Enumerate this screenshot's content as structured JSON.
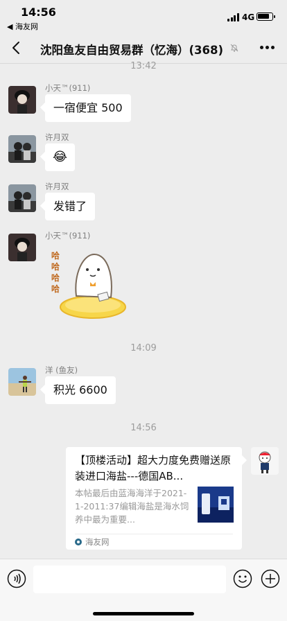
{
  "status_bar": {
    "time": "14:56",
    "back_app": "◀ 海友网",
    "network": "4G",
    "battery_level": 0.85
  },
  "header": {
    "title": "沈阳鱼友自由贸易群（忆海）(368)",
    "muted": true
  },
  "messages": [
    {
      "type": "time",
      "text": "13:42"
    },
    {
      "type": "text",
      "sender": "小天™(911)",
      "text": "一宿便宜 500"
    },
    {
      "type": "emoji",
      "sender": "许月双",
      "emoji": "😂"
    },
    {
      "type": "text",
      "sender": "许月双",
      "text": "发错了"
    },
    {
      "type": "sticker",
      "sender": "小天™(911)",
      "caption": "哈哈哈哈"
    },
    {
      "type": "time",
      "text": "14:09"
    },
    {
      "type": "text",
      "sender": "洋 (鱼友)",
      "text": "积光 6600"
    },
    {
      "type": "time",
      "text": "14:56"
    },
    {
      "type": "link_card",
      "title": "【顶楼活动】超大力度免费赠送原装进口海盐---德国AB...",
      "description": "本帖最后由蓝海海洋于2021-1-2011:37编辑海盐是海水饲养中最为重要...",
      "source": "海友网"
    }
  ],
  "colors": {
    "background": "#ededed",
    "bubble": "#ffffff",
    "time_text": "#9c9c9c",
    "sender_text": "#808080"
  },
  "icons": {
    "back": "chevron-left-icon",
    "mute": "bell-off-icon",
    "more": "more-dots-icon",
    "voice": "voice-icon",
    "emoji": "emoji-icon",
    "plus": "plus-circle-icon"
  }
}
